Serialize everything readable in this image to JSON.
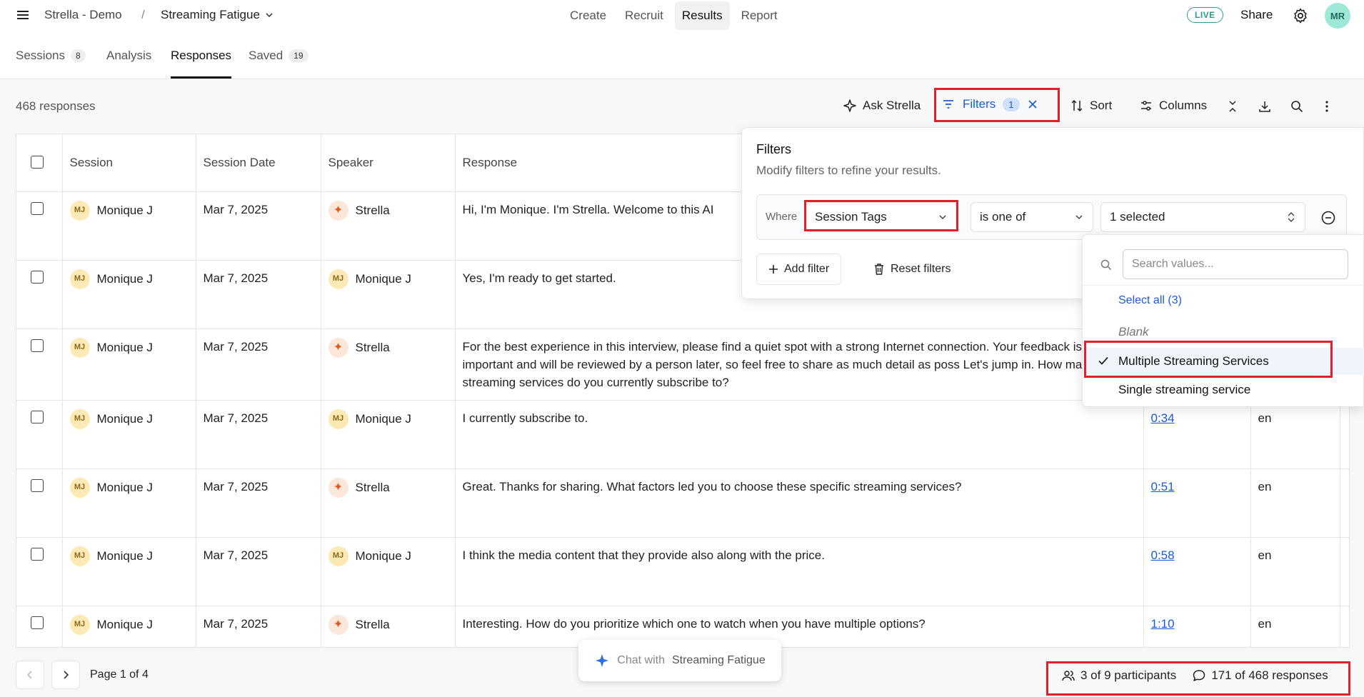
{
  "header": {
    "org": "Strella - Demo",
    "separator": "/",
    "project": "Streaming Fatigue",
    "nav": [
      "Create",
      "Recruit",
      "Results",
      "Report"
    ],
    "active_nav": "Results",
    "live_badge": "LIVE",
    "share_label": "Share",
    "avatar_initials": "MR"
  },
  "tabs": {
    "sessions": {
      "label": "Sessions",
      "count": "8"
    },
    "analysis": {
      "label": "Analysis"
    },
    "responses": {
      "label": "Responses"
    },
    "saved": {
      "label": "Saved",
      "count": "19"
    }
  },
  "toolbar": {
    "response_count": "468 responses",
    "ask_label": "Ask Strella",
    "filters_label": "Filters",
    "filters_count": "1",
    "sort_label": "Sort",
    "columns_label": "Columns"
  },
  "table": {
    "headers": {
      "session": "Session",
      "date": "Session Date",
      "speaker": "Speaker",
      "response": "Response"
    },
    "rows": [
      {
        "session": "Monique J",
        "date": "Mar 7, 2025",
        "speaker": "Strella",
        "speaker_type": "bot",
        "response": "Hi, I'm Monique. I'm Strella. Welcome to this AI",
        "time": "",
        "lang": ""
      },
      {
        "session": "Monique J",
        "date": "Mar 7, 2025",
        "speaker": "Monique J",
        "speaker_type": "user",
        "response": "Yes, I'm ready to get started.",
        "time": "",
        "lang": ""
      },
      {
        "session": "Monique J",
        "date": "Mar 7, 2025",
        "speaker": "Strella",
        "speaker_type": "bot",
        "response": "For the best experience in this interview, please find a quiet spot with a strong Internet connection. Your feedback is important and will be reviewed by a person later, so feel free to share as much detail as poss Let's jump in. How many streaming services do you currently subscribe to?",
        "time": "",
        "lang": ""
      },
      {
        "session": "Monique J",
        "date": "Mar 7, 2025",
        "speaker": "Monique J",
        "speaker_type": "user",
        "response": "I currently subscribe to.",
        "time": "0:34",
        "lang": "en"
      },
      {
        "session": "Monique J",
        "date": "Mar 7, 2025",
        "speaker": "Strella",
        "speaker_type": "bot",
        "response": "Great. Thanks for sharing. What factors led you to choose these specific streaming services?",
        "time": "0:51",
        "lang": "en"
      },
      {
        "session": "Monique J",
        "date": "Mar 7, 2025",
        "speaker": "Monique J",
        "speaker_type": "user",
        "response": "I think the media content that they provide also along with the price.",
        "time": "0:58",
        "lang": "en"
      },
      {
        "session": "Monique J",
        "date": "Mar 7, 2025",
        "speaker": "Strella",
        "speaker_type": "bot",
        "response": "Interesting. How do you prioritize which one to watch when you have multiple options?",
        "time": "1:10",
        "lang": "en"
      }
    ]
  },
  "pager": {
    "label": "Page 1 of 4"
  },
  "chat": {
    "prefix": "Chat with",
    "project": "Streaming Fatigue"
  },
  "stats": {
    "participants": "3 of 9 participants",
    "responses": "171 of 468 responses"
  },
  "filter_panel": {
    "title": "Filters",
    "subtitle": "Modify filters to refine your results.",
    "where": "Where",
    "field": "Session Tags",
    "operator": "is one of",
    "value": "1 selected",
    "add_label": "Add filter",
    "reset_label": "Reset filters"
  },
  "value_dropdown": {
    "placeholder": "Search values...",
    "select_all": "Select all (3)",
    "blank": "Blank",
    "options": [
      "Multiple Streaming Services",
      "Single streaming service"
    ],
    "selected": "Multiple Streaming Services"
  },
  "colors": {
    "accent": "#1a5bd8",
    "highlight": "#e0202c",
    "live": "#2a9d8f"
  }
}
